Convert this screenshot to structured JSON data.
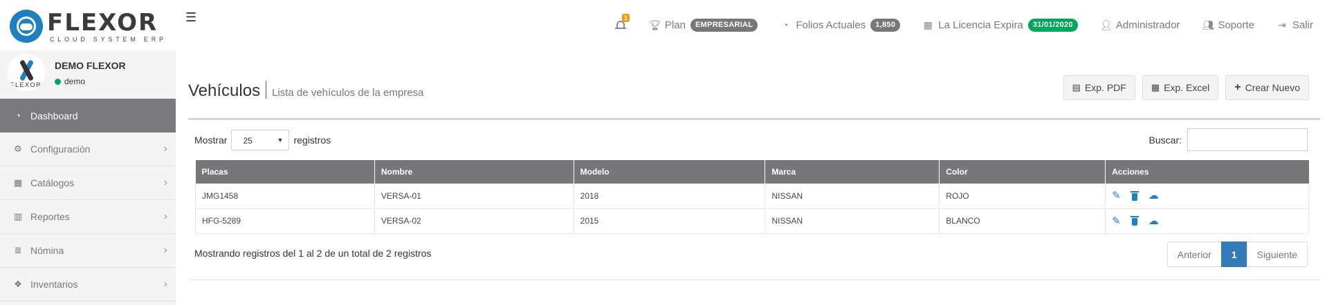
{
  "brand": {
    "name": "FLEXOR",
    "tagline": "CLOUD SYSTEM ERP"
  },
  "topbar": {
    "menu_icon": "hamburger-icon",
    "notifications": {
      "count": "1"
    },
    "plan": {
      "label": "Plan",
      "value": "EMPRESARIAL"
    },
    "folios": {
      "label": "Folios Actuales",
      "value": "1,850"
    },
    "license": {
      "label": "La Licencia Expira",
      "value": "31/01/2020"
    },
    "user": {
      "label": "Administrador"
    },
    "support": {
      "label": "Soporte"
    },
    "logout": {
      "label": "Salir"
    },
    "colors": {
      "plan_badge": "#777777",
      "license_badge": "#00a65a",
      "notif_badge": "#f39c12"
    }
  },
  "sidebar": {
    "user": {
      "name": "DEMO FLEXOR",
      "status": "demo",
      "avatar_text": "FLEXOR"
    },
    "items": [
      {
        "label": "Dashboard",
        "icon": "dashboard-icon",
        "active": true
      },
      {
        "label": "Configuración",
        "icon": "cogs-icon"
      },
      {
        "label": "Catálogos",
        "icon": "grid-icon"
      },
      {
        "label": "Reportes",
        "icon": "bar-chart-icon"
      },
      {
        "label": "Nómina",
        "icon": "database-icon"
      },
      {
        "label": "Inventarios",
        "icon": "dropbox-icon"
      }
    ]
  },
  "page": {
    "title": "Vehículos",
    "subtitle": "Lista de vehículos de la empresa",
    "actions": {
      "pdf": "Exp. PDF",
      "excel": "Exp. Excel",
      "new": "Crear Nuevo"
    }
  },
  "table_controls": {
    "show_label": "Mostrar",
    "page_size": "25",
    "records_label": "registros",
    "search_label": "Buscar:",
    "search_value": ""
  },
  "table": {
    "headers": [
      "Placas",
      "Nombre",
      "Modelo",
      "Marca",
      "Color",
      "Acciones"
    ],
    "rows": [
      [
        "JMG1458",
        "VERSA-01",
        "2018",
        "NISSAN",
        "ROJO"
      ],
      [
        "HFG-5289",
        "VERSA-02",
        "2015",
        "NISSAN",
        "BLANCO"
      ]
    ],
    "row_action_icons": [
      "pencil-icon",
      "trash-icon",
      "cloud-upload-icon"
    ]
  },
  "footer": {
    "info": "Mostrando registros del 1 al 2 de un total de 2 registros",
    "prev": "Anterior",
    "page": "1",
    "next": "Siguiente"
  }
}
